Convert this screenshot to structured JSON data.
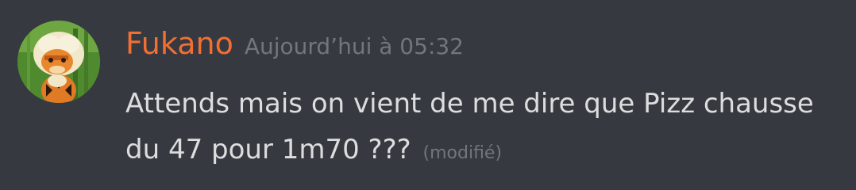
{
  "message": {
    "author": {
      "username": "Fukano",
      "username_color": "#f16f33",
      "avatar_icon": "arcanine-avatar"
    },
    "timestamp": "Aujourd’hui à 05:32",
    "content_line1": "Attends mais on vient de me dire que Pizz chausse",
    "content_line2": "du 47 pour 1m70 ???",
    "edited_label": "(modifié)"
  }
}
